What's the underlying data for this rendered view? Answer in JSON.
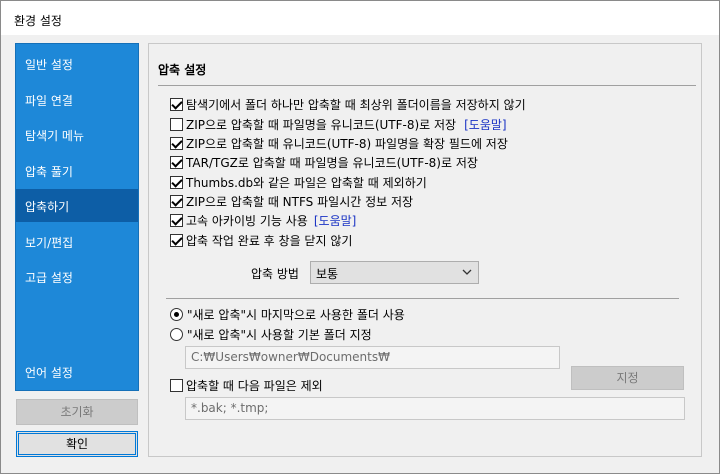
{
  "window": {
    "title": "환경 설정"
  },
  "sidebar": {
    "items": [
      {
        "label": "일반 설정",
        "active": false
      },
      {
        "label": "파일 연결",
        "active": false
      },
      {
        "label": "탐색기 메뉴",
        "active": false
      },
      {
        "label": "압축 풀기",
        "active": false
      },
      {
        "label": "압축하기",
        "active": true
      },
      {
        "label": "보기/편집",
        "active": false
      },
      {
        "label": "고급 설정",
        "active": false
      }
    ],
    "language_label": "언어 설정",
    "reset_label": "초기화",
    "ok_label": "확인"
  },
  "panel": {
    "title": "압축 설정",
    "options": [
      {
        "label": "탐색기에서 폴더 하나만 압축할 때 최상위 폴더이름을 저장하지 않기",
        "checked": true
      },
      {
        "label": "ZIP으로 압축할 때 파일명을 유니코드(UTF-8)로 저장",
        "checked": false,
        "help": "[도움말]"
      },
      {
        "label": "ZIP으로 압축할 때 유니코드(UTF-8) 파일명을 확장 필드에 저장",
        "checked": true
      },
      {
        "label": "TAR/TGZ로 압축할 때 파일명을 유니코드(UTF-8)로 저장",
        "checked": true
      },
      {
        "label": "Thumbs.db와 같은 파일은 압축할 때 제외하기",
        "checked": true
      },
      {
        "label": "ZIP으로 압축할 때 NTFS 파일시간 정보 저장",
        "checked": true
      },
      {
        "label": "고속 아카이빙 기능 사용",
        "checked": true,
        "help": "[도움말]"
      },
      {
        "label": "압축 작업 완료 후 창을 닫지 않기",
        "checked": true
      }
    ],
    "method": {
      "label": "압축 방법",
      "value": "보통"
    },
    "folder": {
      "radio_last": {
        "label": "\"새로 압축\"시 마지막으로 사용한 폴더 사용",
        "checked": true
      },
      "radio_default": {
        "label": "\"새로 압축\"시 사용할 기본 폴더 지정",
        "checked": false
      },
      "path": "C:₩Users₩owner₩Documents₩",
      "browse_label": "지정"
    },
    "exclude": {
      "label": "압축할 때 다음 파일은 제외",
      "checked": false,
      "patterns": "*.bak; *.tmp;"
    }
  },
  "colors": {
    "sidebar": "#1e88d8",
    "sidebar_active": "#0d5ea6",
    "help_link": "#1a33c4"
  }
}
